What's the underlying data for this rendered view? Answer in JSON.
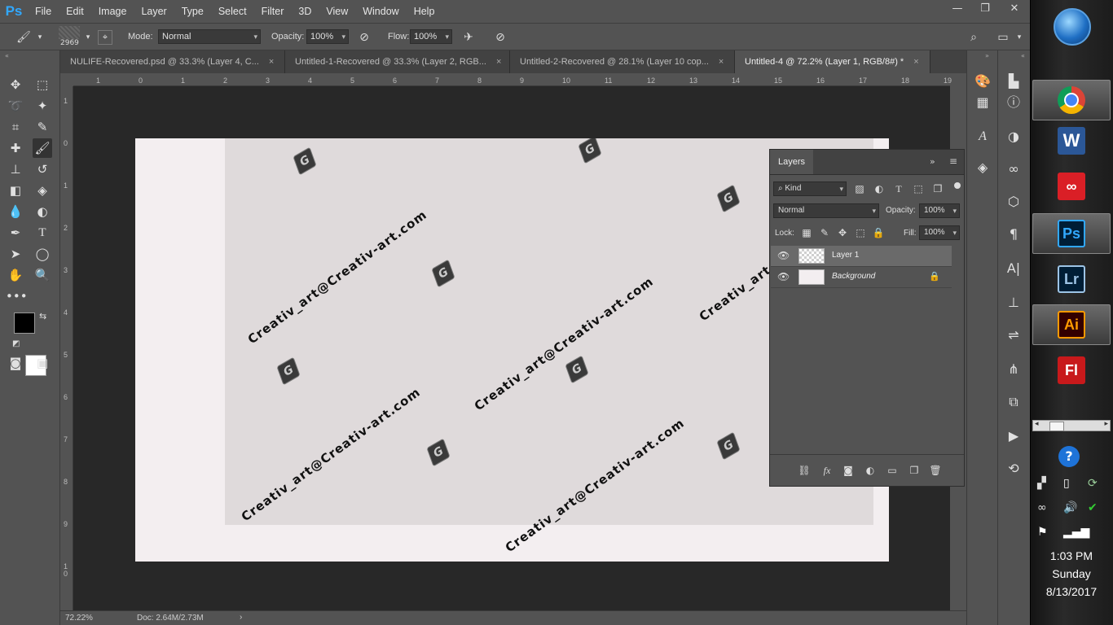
{
  "menu": {
    "logo": "Ps",
    "items": [
      "File",
      "Edit",
      "Image",
      "Layer",
      "Type",
      "Select",
      "Filter",
      "3D",
      "View",
      "Window",
      "Help"
    ]
  },
  "window_controls": {
    "minimize": "—",
    "restore": "❐",
    "close": "✕"
  },
  "options": {
    "brush_size": "2969",
    "mode_label": "Mode:",
    "mode_value": "Normal",
    "opacity_label": "Opacity:",
    "opacity_value": "100%",
    "flow_label": "Flow:",
    "flow_value": "100%"
  },
  "tabs": [
    {
      "label": "NULIFE-Recovered.psd @ 33.3% (Layer 4, C...",
      "close": "×"
    },
    {
      "label": "Untitled-1-Recovered @ 33.3% (Layer 2, RGB...",
      "close": "×"
    },
    {
      "label": "Untitled-2-Recovered @ 28.1% (Layer 10 cop...",
      "close": "×"
    },
    {
      "label": "Untitled-4 @ 72.2% (Layer 1, RGB/8#) *",
      "close": "×"
    }
  ],
  "ruler": {
    "h_ticks": [
      "1",
      "0",
      "1",
      "2",
      "3",
      "4",
      "5",
      "6",
      "7",
      "8",
      "9",
      "10",
      "11",
      "12",
      "13",
      "14",
      "15",
      "16",
      "17",
      "18",
      "19"
    ],
    "v_ticks": [
      "1",
      "0",
      "1",
      "2",
      "3",
      "4",
      "5",
      "6",
      "7",
      "8",
      "9",
      "1\n0"
    ]
  },
  "watermark": {
    "text": "Creativ_art@Creativ-art.com",
    "logo_glyph": "G"
  },
  "status": {
    "zoom": "72.22%",
    "doc": "Doc: 2.64M/2.73M",
    "arrow": "›"
  },
  "layers_panel": {
    "title": "Layers",
    "filter_value": "Kind",
    "blend_value": "Normal",
    "opacity_label": "Opacity:",
    "opacity_value": "100%",
    "lock_label": "Lock:",
    "fill_label": "Fill:",
    "fill_value": "100%",
    "layers": [
      {
        "name": "Layer 1",
        "selected": true
      },
      {
        "name": "Background",
        "selected": false
      }
    ]
  },
  "taskbar": {
    "apps": [
      "Chrome",
      "W",
      "Creative Cloud",
      "Ps",
      "Lr",
      "Ai",
      "Fl"
    ],
    "time": "1:03 PM",
    "day": "Sunday",
    "date": "8/13/2017"
  },
  "colors": {
    "ps_blue": "#31a8ff",
    "canvas_bg": "#282828",
    "doc_bg": "#f3eef0",
    "doc_inner": "#dfdadb"
  }
}
